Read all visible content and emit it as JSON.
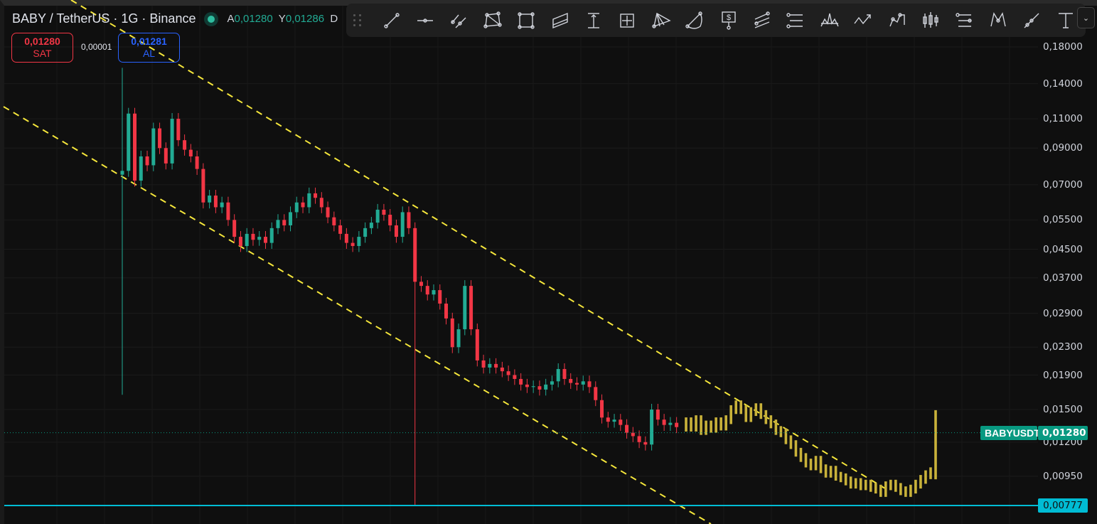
{
  "header": {
    "symbol": "BABY / TetherUS · 1G · Binance",
    "open_label": "A",
    "open_value": "0,01280",
    "high_label": "Y",
    "high_value": "0,01286",
    "trailing": "D"
  },
  "trade": {
    "sell_price": "0,01280",
    "sell_label": "SAT",
    "spread": "0,00001",
    "buy_price": "0,01281",
    "buy_label": "AL"
  },
  "toolbar": {
    "tools": [
      "trend-line",
      "horizontal-ray",
      "parallel-lines",
      "xabcd-pattern",
      "rectangle",
      "parallel-channel",
      "price-range",
      "date-price-range",
      "pitchfork",
      "arc",
      "price-label",
      "multi-line",
      "fib-retracement",
      "head-shoulders",
      "arrow-path",
      "elliott-wave",
      "candles-pattern",
      "fib-levels",
      "abcd-pattern",
      "ray",
      "text"
    ]
  },
  "colors": {
    "up": "#22ab94",
    "down": "#f23645",
    "projection": "#c9b23a",
    "channel": "#f5e63b",
    "hline": "#00bcd4",
    "last": "#089981"
  },
  "chart_data": {
    "type": "candlestick",
    "scale": "log",
    "symbol_tag": "BABYUSDT",
    "last_price": 0.0128,
    "last_price_label": "0,01280",
    "hline_price": 0.00777,
    "hline_label": "0,00777",
    "ylim": [
      0.0071,
      0.21
    ],
    "y_ticks": [
      {
        "v": 0.18,
        "l": "0,18000"
      },
      {
        "v": 0.14,
        "l": "0,14000"
      },
      {
        "v": 0.11,
        "l": "0,11000"
      },
      {
        "v": 0.09,
        "l": "0,09000"
      },
      {
        "v": 0.07,
        "l": "0,07000"
      },
      {
        "v": 0.055,
        "l": "0,05500"
      },
      {
        "v": 0.045,
        "l": "0,04500"
      },
      {
        "v": 0.037,
        "l": "0,03700"
      },
      {
        "v": 0.029,
        "l": "0,02900"
      },
      {
        "v": 0.023,
        "l": "0,02300"
      },
      {
        "v": 0.019,
        "l": "0,01900"
      },
      {
        "v": 0.015,
        "l": "0,01500"
      },
      {
        "v": 0.012,
        "l": "0,01200"
      },
      {
        "v": 0.0095,
        "l": "0,00950"
      }
    ],
    "first_candle": {
      "open": 0.075,
      "high": 0.156,
      "low": 0.0166,
      "close": 0.077
    },
    "closes": [
      0.077,
      0.114,
      0.072,
      0.085,
      0.08,
      0.103,
      0.09,
      0.081,
      0.11,
      0.095,
      0.089,
      0.085,
      0.078,
      0.062,
      0.065,
      0.06,
      0.062,
      0.055,
      0.049,
      0.046,
      0.05,
      0.048,
      0.049,
      0.047,
      0.052,
      0.055,
      0.053,
      0.058,
      0.062,
      0.06,
      0.066,
      0.064,
      0.06,
      0.056,
      0.053,
      0.05,
      0.047,
      0.046,
      0.049,
      0.052,
      0.054,
      0.059,
      0.057,
      0.053,
      0.049,
      0.058,
      0.052,
      0.036,
      0.035,
      0.033,
      0.034,
      0.031,
      0.028,
      0.023,
      0.026,
      0.035,
      0.026,
      0.021,
      0.02,
      0.0205,
      0.02,
      0.0195,
      0.019,
      0.0185,
      0.0178,
      0.0175,
      0.0176,
      0.0172,
      0.0178,
      0.0182,
      0.0198,
      0.0185,
      0.018,
      0.0178,
      0.0182,
      0.0175,
      0.016,
      0.0142,
      0.0138,
      0.014,
      0.0135,
      0.0128,
      0.0125,
      0.012,
      0.0118,
      0.015,
      0.014,
      0.0135,
      0.0137,
      0.0133
    ],
    "deep_wick": {
      "index": 47,
      "low": 0.00777
    },
    "projection_closes": [
      0.0138,
      0.0133,
      0.014,
      0.013,
      0.0135,
      0.0132,
      0.0138,
      0.0134,
      0.014,
      0.015,
      0.0155,
      0.015,
      0.0142,
      0.0148,
      0.0152,
      0.0145,
      0.014,
      0.0136,
      0.013,
      0.0128,
      0.0122,
      0.0118,
      0.0112,
      0.0108,
      0.0104,
      0.0102,
      0.0106,
      0.01,
      0.0097,
      0.0099,
      0.0095,
      0.0094,
      0.0092,
      0.009,
      0.0091,
      0.0089,
      0.009,
      0.0088,
      0.0087,
      0.0085,
      0.0089,
      0.009,
      0.0088,
      0.0086,
      0.0085,
      0.0087,
      0.009,
      0.0093,
      0.0096,
      0.0098,
      0.0145
    ]
  }
}
